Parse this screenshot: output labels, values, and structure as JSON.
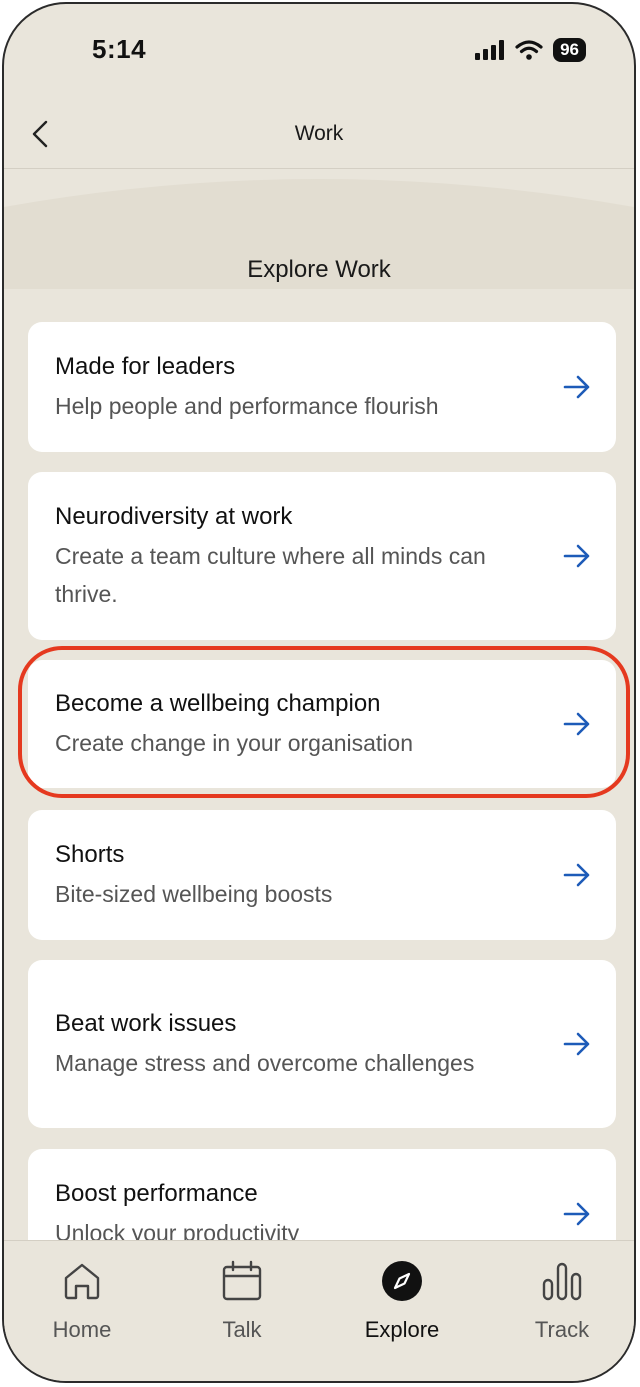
{
  "status_bar": {
    "time": "5:14",
    "battery": "96"
  },
  "nav": {
    "title": "Work"
  },
  "section": {
    "title": "Explore Work"
  },
  "cards": [
    {
      "title": "Made for leaders",
      "subtitle": "Help people and performance flourish"
    },
    {
      "title": "Neurodiversity at work",
      "subtitle": "Create a team culture where all minds can thrive."
    },
    {
      "title": "Become a wellbeing champion",
      "subtitle": "Create change in your organisation"
    },
    {
      "title": "Shorts",
      "subtitle": "Bite-sized wellbeing boosts"
    },
    {
      "title": "Beat work issues",
      "subtitle": "Manage stress and overcome challenges"
    },
    {
      "title": "Boost performance",
      "subtitle": "Unlock your productivity"
    }
  ],
  "tabs": [
    {
      "label": "Home",
      "icon": "home-icon"
    },
    {
      "label": "Talk",
      "icon": "calendar-icon"
    },
    {
      "label": "Explore",
      "icon": "compass-icon",
      "active": true
    },
    {
      "label": "Track",
      "icon": "bar-chart-icon"
    }
  ],
  "colors": {
    "accent_arrow": "#1d5bb8",
    "highlight": "#e5391f",
    "background": "#e9e5db"
  }
}
